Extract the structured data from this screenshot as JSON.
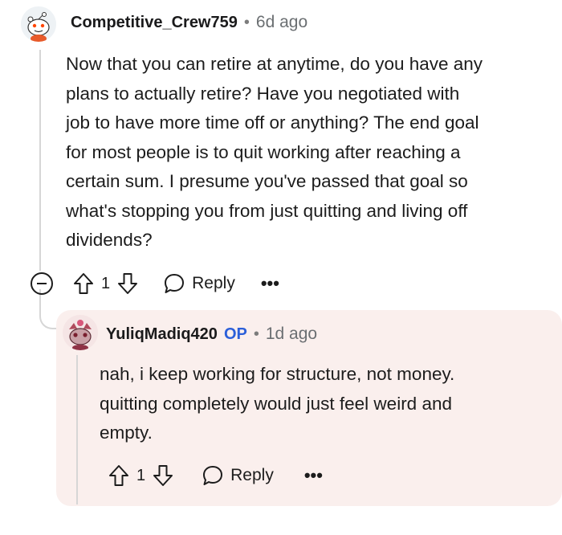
{
  "comment": {
    "username": "Competitive_Crew759",
    "time": "6d ago",
    "body_lines": [
      "Now that you can retire at anytime, do you have any",
      "plans to actually retire? Have you negotiated with",
      "job to have more time off or anything? The end goal",
      "for most people is to quit working after reaching a",
      "certain sum. I presume you've passed that goal so",
      "what's stopping you from just quitting and living off",
      "dividends?"
    ],
    "vote_count": "1",
    "reply_label": "Reply",
    "more_label": "•••"
  },
  "reply": {
    "username": "YuliqMadiq420",
    "op_badge": "OP",
    "time": "1d ago",
    "body_lines": [
      "nah, i keep working for structure, not money.",
      "quitting completely would just feel weird and",
      "empty."
    ],
    "vote_count": "1",
    "reply_label": "Reply",
    "more_label": "•••"
  },
  "colors": {
    "op_badge": "#2b5fd9",
    "reply_background": "#faefed",
    "thread_line": "#d6d6d6"
  },
  "icons": [
    "snoo-avatar-icon",
    "upvote-icon",
    "downvote-icon",
    "comment-bubble-icon",
    "collapse-icon",
    "more-options-icon"
  ]
}
